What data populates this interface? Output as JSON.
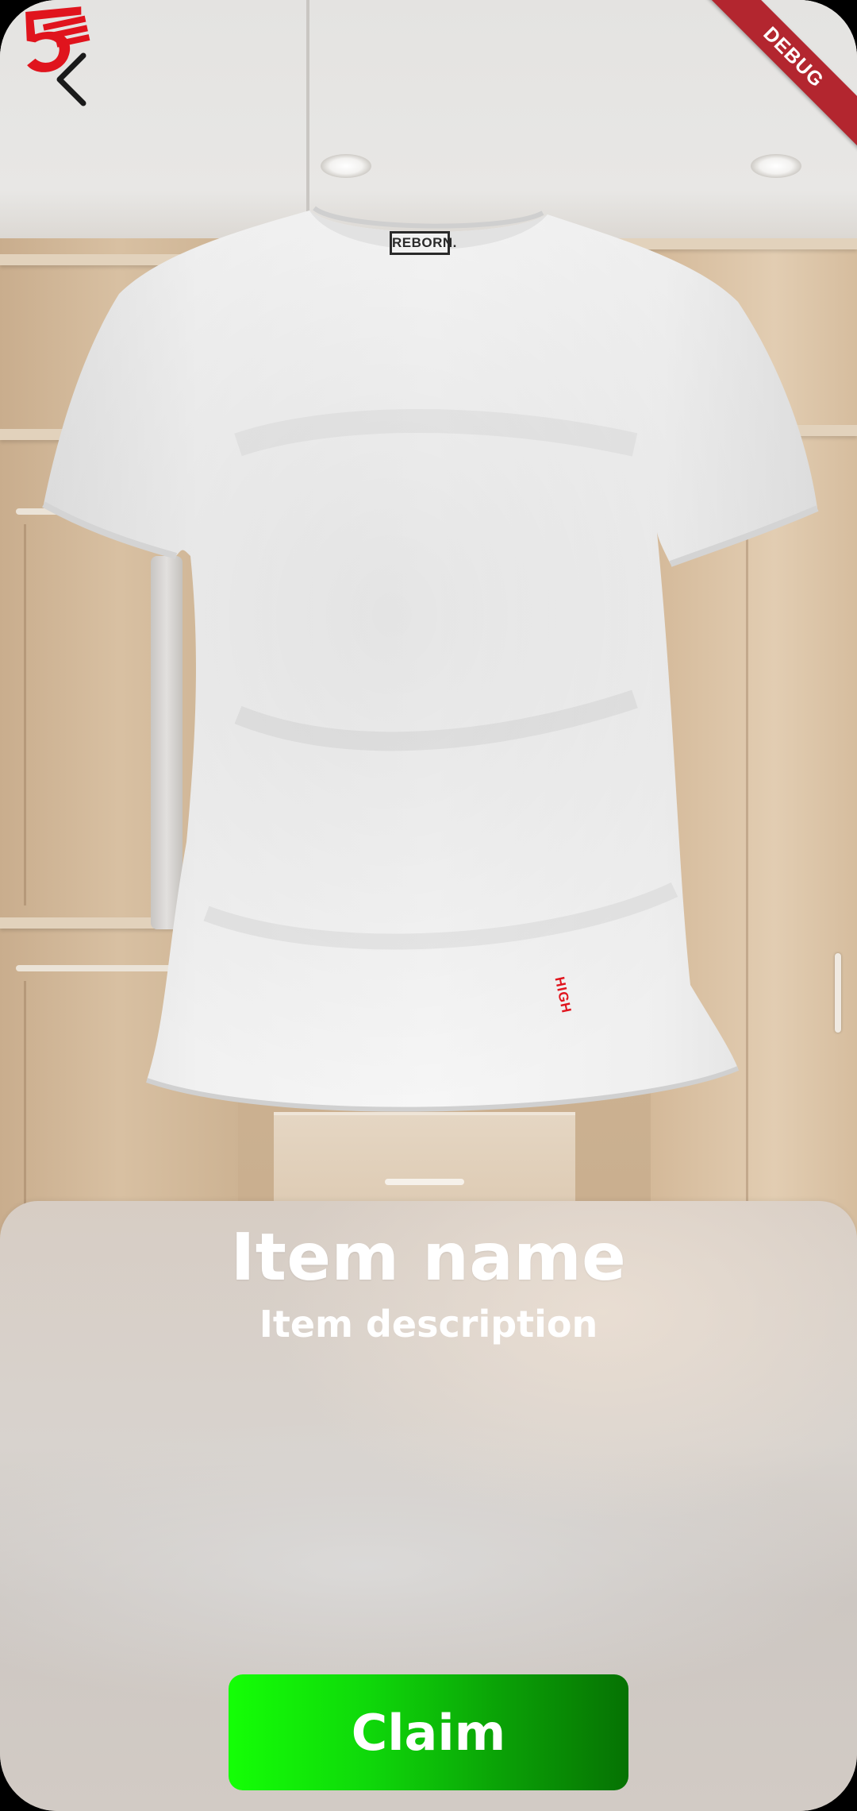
{
  "header": {
    "back_icon": "chevron-left-icon",
    "debug_label": "DEBUG"
  },
  "product_image": {
    "brand_tag": "REBORN.",
    "logo_number": "5",
    "logo_word": "HIGH",
    "logo_color": "#e0141d"
  },
  "item": {
    "name": "Item name",
    "description": "Item description"
  },
  "actions": {
    "claim_label": "Claim",
    "claim_color_start": "#14ff06",
    "claim_color_end": "#067203"
  }
}
